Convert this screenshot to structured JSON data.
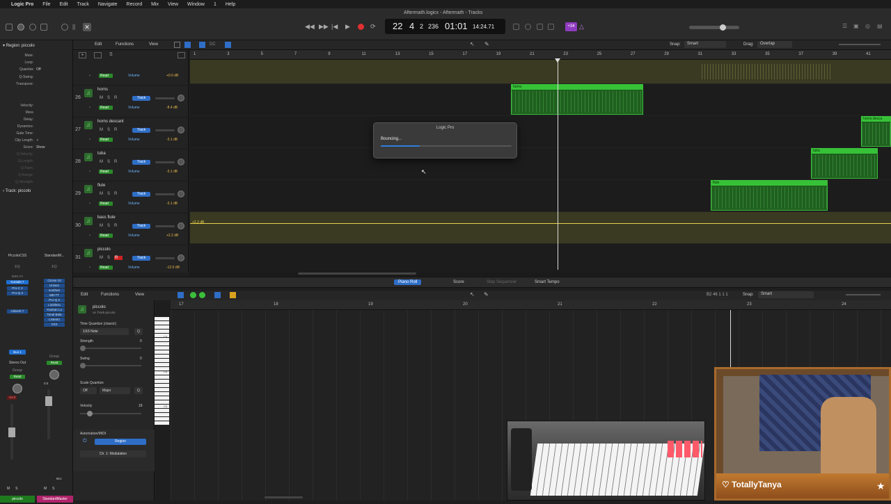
{
  "menubar": {
    "apple": "",
    "items": [
      "Logic Pro",
      "File",
      "Edit",
      "Track",
      "Navigate",
      "Record",
      "Mix",
      "View",
      "Window",
      "1",
      "Help"
    ]
  },
  "window": {
    "title": "Aftermath.logicx - Aftermath - Tracks"
  },
  "lcd": {
    "bar": "22",
    "beat": "4",
    "div": "2",
    "tick": "236",
    "time": "01:01",
    "frames": "14:24.71"
  },
  "toolbar": {
    "count_badge": "+34"
  },
  "inspector": {
    "region_label": "Region:",
    "region_name": "piccolo",
    "fields": [
      {
        "k": "Mute:",
        "v": ""
      },
      {
        "k": "Loop:",
        "v": ""
      },
      {
        "k": "Quantize",
        "v": "Off"
      },
      {
        "k": "Q-Swing:",
        "v": ""
      },
      {
        "k": "Transpose:",
        "v": ""
      },
      {
        "k": "Velocity:",
        "v": ""
      },
      {
        "k": "More",
        "v": ""
      },
      {
        "k": "Delay:",
        "v": ""
      },
      {
        "k": "Dynamics:",
        "v": ""
      },
      {
        "k": "Gate Time:",
        "v": ""
      },
      {
        "k": "Clip Length:",
        "v": "✓"
      },
      {
        "k": "Score:",
        "v": "Show"
      },
      {
        "k": "Q-Velocity:",
        "v": ""
      },
      {
        "k": "Q-Length:",
        "v": ""
      },
      {
        "k": "Q-Flam:",
        "v": ""
      },
      {
        "k": "Q-Range:",
        "v": ""
      },
      {
        "k": "Q-Strength:",
        "v": ""
      }
    ],
    "track_label": "Track:",
    "track_name": "piccolo",
    "strip1": {
      "name": "PiccoloCSS",
      "setting": "EQ",
      "midi": "MIDI FX",
      "inst": "Kontakt 7",
      "plugins": [
        "Pro-C 2",
        "Pro-Q 3",
        "Altiverb 7"
      ],
      "bus": "Bus 1",
      "out": "Stereo Out",
      "group": "Group",
      "read": "Read",
      "db": "-12.0",
      "label": "piccolo"
    },
    "strip2": {
      "name": "StandardM...",
      "setting": "EQ",
      "plugins": [
        "Ozone 10",
        "Unison",
        "soothe2",
        "MD-TT",
        "Pro-Q 3",
        "Limitless",
        "Youlean Lo",
        "Tonal Bala",
        "Listento",
        "VSX"
      ],
      "group": "Group",
      "read": "Read",
      "db": "0.0",
      "bnc": "Bnc",
      "label": "StandardMaster"
    }
  },
  "tracks_toolbar": {
    "edit": "Edit",
    "functions": "Functions",
    "view": "View",
    "snap_label": "Snap:",
    "snap": "Smart",
    "drag_label": "Drag:",
    "drag": "Overlap"
  },
  "ruler": [
    "1",
    "3",
    "5",
    "7",
    "9",
    "11",
    "13",
    "15",
    "17",
    "19",
    "21",
    "23",
    "25",
    "27",
    "29",
    "31",
    "33",
    "35",
    "37",
    "39",
    "41"
  ],
  "tracks": [
    {
      "num": "",
      "name": "",
      "db": "+0.0 dB"
    },
    {
      "num": "26",
      "name": "horns",
      "db": "-8.4 dB"
    },
    {
      "num": "27",
      "name": "horns descant",
      "db": "-3.1 dB"
    },
    {
      "num": "28",
      "name": "tuba",
      "db": "-3.1 dB"
    },
    {
      "num": "29",
      "name": "flute",
      "db": "-3.1 dB"
    },
    {
      "num": "30",
      "name": "bass flute",
      "db": "+2.2 dB"
    },
    {
      "num": "31",
      "name": "piccolo",
      "db": "-12.0 dB"
    }
  ],
  "track_common": {
    "mute": "M",
    "solo": "S",
    "rec": "R",
    "track_btn": "Track",
    "read": "Read",
    "volume": "Volume"
  },
  "regions": {
    "horns": "horns",
    "horns_descant": "horns desca",
    "tuba": "tuba",
    "flute": "flute",
    "bass_flute_db": "+2.2 dB"
  },
  "dialog": {
    "title": "Logic Pro",
    "message": "Bouncing...",
    "progress": 0.3
  },
  "bottom_tabs": [
    "Piano Roll",
    "Score",
    "Step Sequencer",
    "Smart Tempo"
  ],
  "piano_roll": {
    "edit": "Edit",
    "functions": "Functions",
    "view": "View",
    "position": "B2  46 1 1 1",
    "snap_label": "Snap:",
    "snap": "Smart",
    "region_name": "piccolo",
    "region_sub": "on Track piccolo",
    "tq_label": "Time Quantize (classic)",
    "tq_value": "1/16 Note",
    "strength_label": "Strength",
    "strength": "0",
    "swing_label": "Swing",
    "swing": "0",
    "sq_label": "Scale Quantize",
    "sq_off": "Off",
    "sq_mode": "Major",
    "velocity_label": "Velocity",
    "velocity": "18",
    "automation_label": "Automation/MIDI",
    "region_btn": "Region",
    "modulation": "Ch. 1: Modulation",
    "ruler": [
      "17",
      "18",
      "19",
      "20",
      "21",
      "22",
      "23",
      "24"
    ],
    "keys": [
      "C5",
      "C4",
      "C3"
    ]
  },
  "overlay": {
    "streamer": "TotallyTanya"
  }
}
